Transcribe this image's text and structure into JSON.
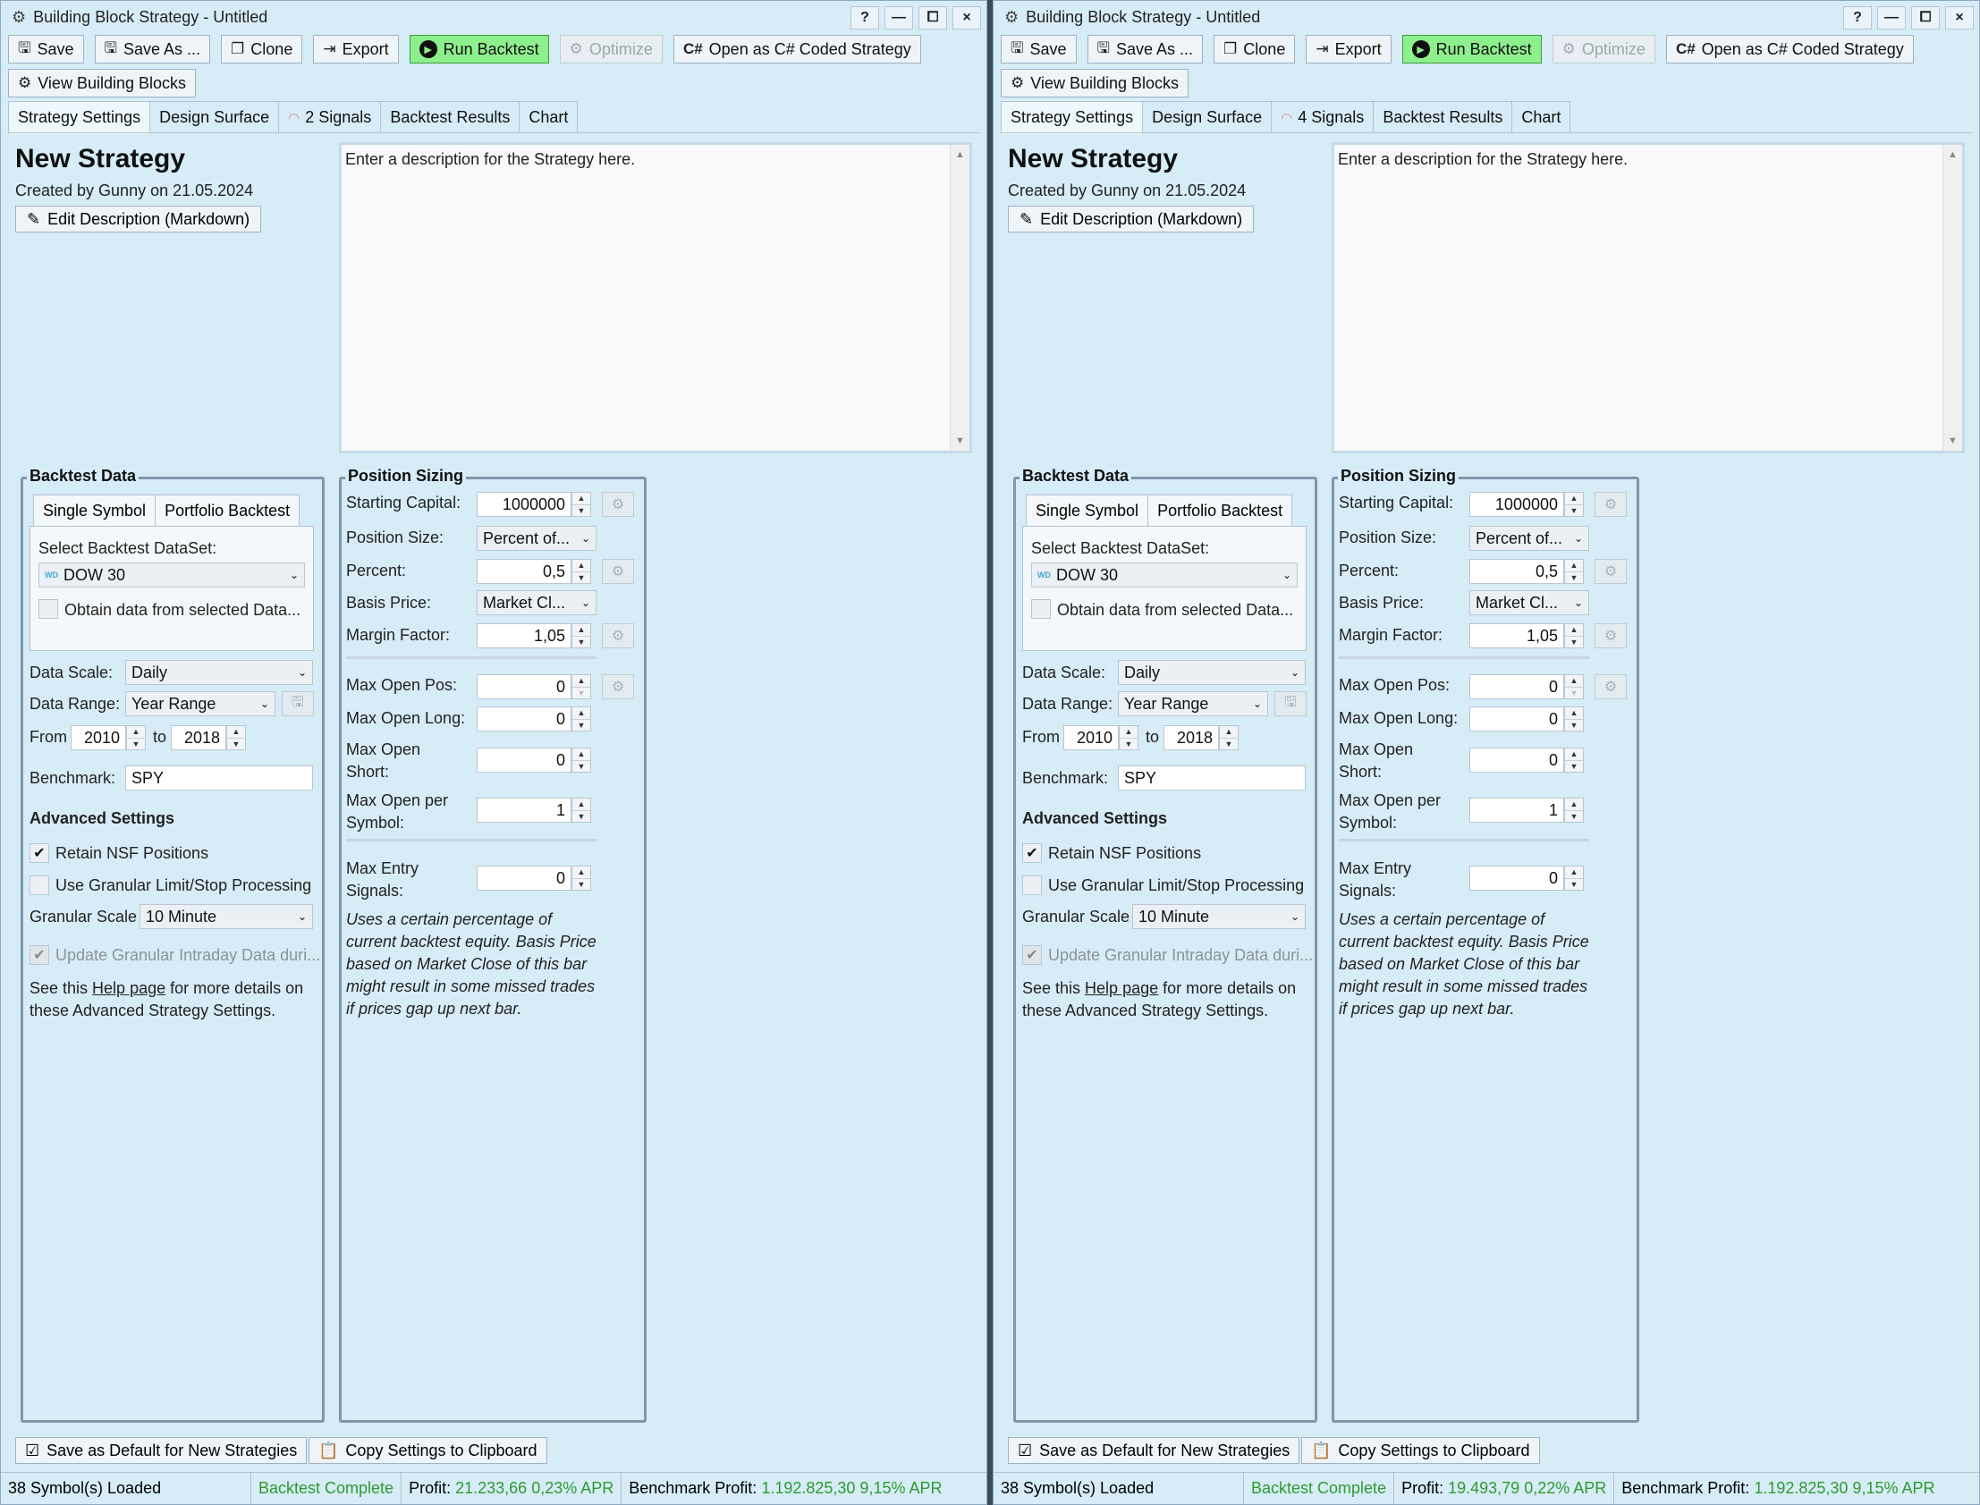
{
  "windows": [
    {
      "title": "Building Block Strategy - Untitled",
      "title_buttons": [
        "?",
        "—",
        "⧠",
        "×"
      ],
      "toolbar": {
        "save": "Save",
        "save_as": "Save As ...",
        "clone": "Clone",
        "export": "Export",
        "run_backtest": "Run Backtest",
        "optimize": "Optimize",
        "open_csharp": "Open as C# Coded Strategy",
        "view_blocks": "View Building Blocks"
      },
      "tabs": {
        "strategy_settings": "Strategy Settings",
        "design_surface": "Design Surface",
        "signals": "2 Signals",
        "backtest_results": "Backtest Results",
        "chart": "Chart"
      },
      "strategy": {
        "name": "New Strategy",
        "created": "Created by Gunny on 21.05.2024",
        "edit_description": "Edit Description (Markdown)",
        "description": "Enter a description for the Strategy here."
      },
      "backtest_data": {
        "title": "Backtest Data",
        "tab_single": "Single Symbol",
        "tab_portfolio": "Portfolio Backtest",
        "select_dataset_label": "Select Backtest DataSet:",
        "dataset": "DOW 30",
        "dataset_badge": "WD",
        "obtain_data": "Obtain data from selected Data...",
        "data_scale_label": "Data Scale:",
        "data_scale": "Daily",
        "data_range_label": "Data Range:",
        "data_range": "Year Range",
        "from_label": "From",
        "from": "2010",
        "to_label": "to",
        "to": "2018",
        "benchmark_label": "Benchmark:",
        "benchmark": "SPY",
        "advanced_title": "Advanced Settings",
        "retain_nsf": "Retain NSF Positions",
        "granular_processing": "Use Granular Limit/Stop Processing",
        "granular_scale_label": "Granular Scale",
        "granular_scale": "10 Minute",
        "update_granular": "Update Granular Intraday Data duri...",
        "help_pre": "See this ",
        "help_link": "Help page",
        "help_post": " for more details on",
        "help_line2": "these Advanced Strategy Settings."
      },
      "position_sizing": {
        "title": "Position Sizing",
        "starting_capital_label": "Starting Capital:",
        "starting_capital": "1000000",
        "position_size_label": "Position Size:",
        "position_size": "Percent of...",
        "percent_label": "Percent:",
        "percent": "0,5",
        "basis_price_label": "Basis Price:",
        "basis_price": "Market Cl...",
        "margin_factor_label": "Margin Factor:",
        "margin_factor": "1,05",
        "max_open_pos_label": "Max Open Pos:",
        "max_open_pos": "0",
        "max_open_long_label": "Max Open Long:",
        "max_open_long": "0",
        "max_open_short_label1": "Max Open",
        "max_open_short_label2": "Short:",
        "max_open_short": "0",
        "max_open_per_symbol_label1": "Max Open per",
        "max_open_per_symbol_label2": "Symbol:",
        "max_open_per_symbol": "1",
        "max_entry_label1": "Max Entry",
        "max_entry_label2": "Signals:",
        "max_entry": "0",
        "note1": "Uses a certain percentage of",
        "note2": "current backtest equity. Basis Price",
        "note3": "based on Market Close of this bar",
        "note4": "might result in some missed trades",
        "note5": "if prices gap up next bar."
      },
      "footer": {
        "save_default": "Save as Default for New Strategies",
        "copy_settings": "Copy Settings to Clipboard"
      },
      "status": {
        "symbols": "38 Symbol(s) Loaded",
        "backtest": "Backtest Complete",
        "profit_label": "Profit:",
        "profit": "21.233,66 0,23% APR",
        "benchmark_label": "Benchmark Profit:",
        "benchmark": "1.192.825,30 9,15% APR"
      }
    },
    {
      "title": "Building Block Strategy - Untitled",
      "title_buttons": [
        "?",
        "—",
        "⧠",
        "×"
      ],
      "toolbar": {
        "save": "Save",
        "save_as": "Save As ...",
        "clone": "Clone",
        "export": "Export",
        "run_backtest": "Run Backtest",
        "optimize": "Optimize",
        "open_csharp": "Open as C# Coded Strategy",
        "view_blocks": "View Building Blocks"
      },
      "tabs": {
        "strategy_settings": "Strategy Settings",
        "design_surface": "Design Surface",
        "signals": "4 Signals",
        "backtest_results": "Backtest Results",
        "chart": "Chart"
      },
      "strategy": {
        "name": "New Strategy",
        "created": "Created by Gunny on 21.05.2024",
        "edit_description": "Edit Description (Markdown)",
        "description": "Enter a description for the Strategy here."
      },
      "backtest_data": {
        "title": "Backtest Data",
        "tab_single": "Single Symbol",
        "tab_portfolio": "Portfolio Backtest",
        "select_dataset_label": "Select Backtest DataSet:",
        "dataset": "DOW 30",
        "dataset_badge": "WD",
        "obtain_data": "Obtain data from selected Data...",
        "data_scale_label": "Data Scale:",
        "data_scale": "Daily",
        "data_range_label": "Data Range:",
        "data_range": "Year Range",
        "from_label": "From",
        "from": "2010",
        "to_label": "to",
        "to": "2018",
        "benchmark_label": "Benchmark:",
        "benchmark": "SPY",
        "advanced_title": "Advanced Settings",
        "retain_nsf": "Retain NSF Positions",
        "granular_processing": "Use Granular Limit/Stop Processing",
        "granular_scale_label": "Granular Scale",
        "granular_scale": "10 Minute",
        "update_granular": "Update Granular Intraday Data duri...",
        "help_pre": "See this ",
        "help_link": "Help page",
        "help_post": " for more details on",
        "help_line2": "these Advanced Strategy Settings."
      },
      "position_sizing": {
        "title": "Position Sizing",
        "starting_capital_label": "Starting Capital:",
        "starting_capital": "1000000",
        "position_size_label": "Position Size:",
        "position_size": "Percent of...",
        "percent_label": "Percent:",
        "percent": "0,5",
        "basis_price_label": "Basis Price:",
        "basis_price": "Market Cl...",
        "margin_factor_label": "Margin Factor:",
        "margin_factor": "1,05",
        "max_open_pos_label": "Max Open Pos:",
        "max_open_pos": "0",
        "max_open_long_label": "Max Open Long:",
        "max_open_long": "0",
        "max_open_short_label1": "Max Open",
        "max_open_short_label2": "Short:",
        "max_open_short": "0",
        "max_open_per_symbol_label1": "Max Open per",
        "max_open_per_symbol_label2": "Symbol:",
        "max_open_per_symbol": "1",
        "max_entry_label1": "Max Entry",
        "max_entry_label2": "Signals:",
        "max_entry": "0",
        "note1": "Uses a certain percentage of",
        "note2": "current backtest equity. Basis Price",
        "note3": "based on Market Close of this bar",
        "note4": "might result in some missed trades",
        "note5": "if prices gap up next bar."
      },
      "footer": {
        "save_default": "Save as Default for New Strategies",
        "copy_settings": "Copy Settings to Clipboard"
      },
      "status": {
        "symbols": "38 Symbol(s) Loaded",
        "backtest": "Backtest Complete",
        "profit_label": "Profit:",
        "profit": "19.493,79 0,22% APR",
        "benchmark_label": "Benchmark Profit:",
        "benchmark": "1.192.825,30 9,15% APR"
      }
    }
  ]
}
